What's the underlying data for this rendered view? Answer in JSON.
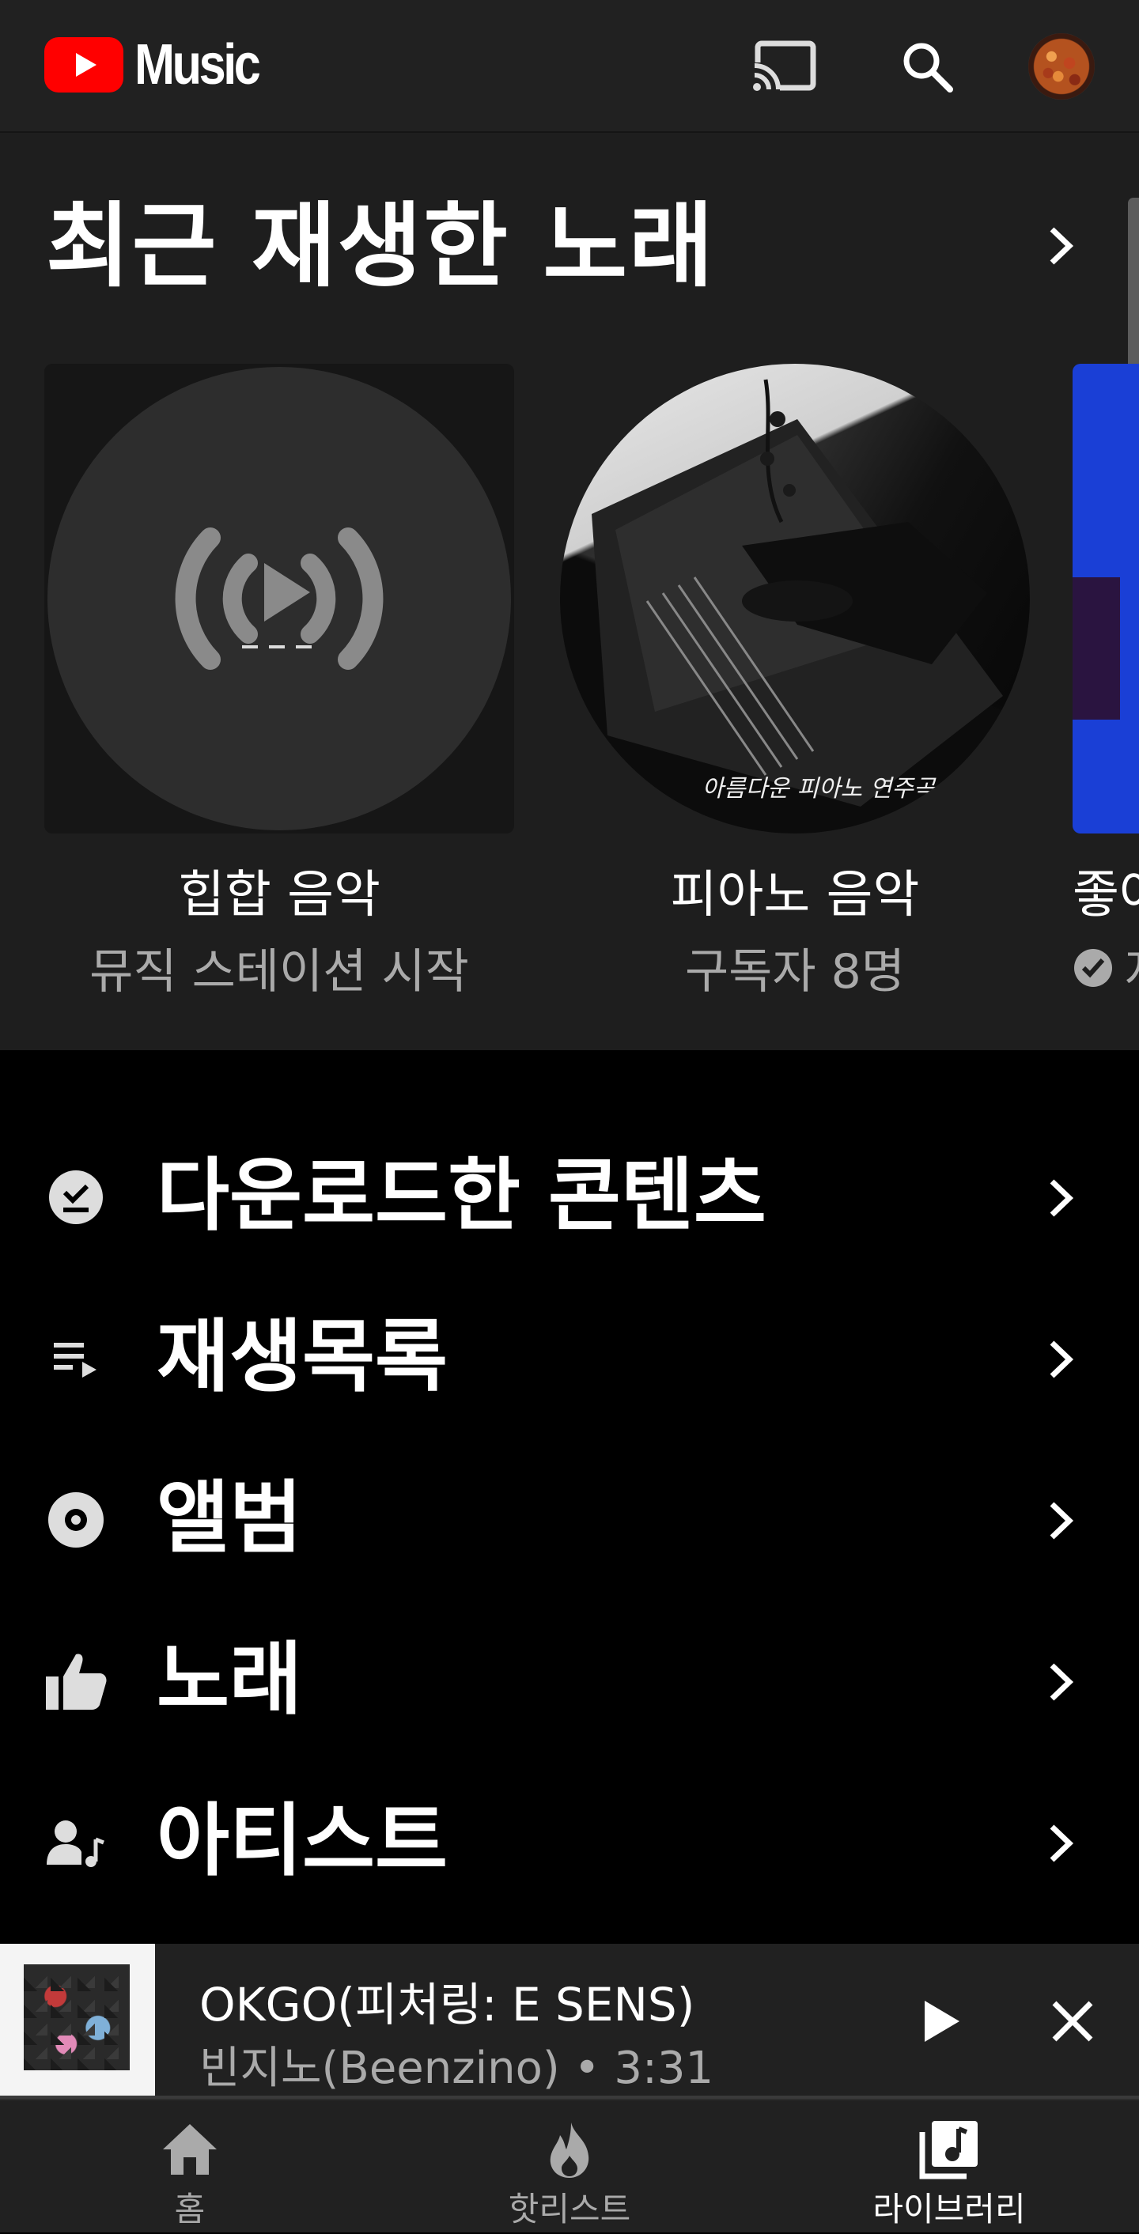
{
  "app": {
    "logo_text": "Music",
    "brand_red": "#ff0000"
  },
  "topbar": {
    "cast_icon": "cast-icon",
    "search_icon": "search-icon",
    "avatar": "account-avatar"
  },
  "recent": {
    "title": "최근 재생한 노래",
    "more_icon": "chevron-right-icon",
    "cards": [
      {
        "title": "힙합 음악",
        "subtitle": "뮤직 스테이션 시작",
        "thumb": "radio-station-icon"
      },
      {
        "title": "피아노 음악",
        "subtitle": "구독자 8명",
        "thumb_caption": "아름다운 피아노 연주곡"
      },
      {
        "title": "좋아",
        "subtitle": "자",
        "badge_icon": "download-check-icon"
      }
    ]
  },
  "library": {
    "items": [
      {
        "label": "다운로드한 콘텐츠",
        "icon": "download-check-icon"
      },
      {
        "label": "재생목록",
        "icon": "playlist-icon"
      },
      {
        "label": "앨범",
        "icon": "album-icon"
      },
      {
        "label": "노래",
        "icon": "thumbs-up-icon"
      },
      {
        "label": "아티스트",
        "icon": "artist-icon"
      }
    ]
  },
  "player": {
    "title": "OKGO(피처링: E SENS)",
    "subtitle": "빈지노(Beenzino) • 3:31",
    "play_icon": "play-icon",
    "close_icon": "close-icon",
    "progress": 0
  },
  "nav": {
    "items": [
      {
        "label": "홈",
        "icon": "home-icon",
        "active": false
      },
      {
        "label": "핫리스트",
        "icon": "flame-icon",
        "active": false
      },
      {
        "label": "라이브러리",
        "icon": "library-icon",
        "active": true
      }
    ]
  }
}
